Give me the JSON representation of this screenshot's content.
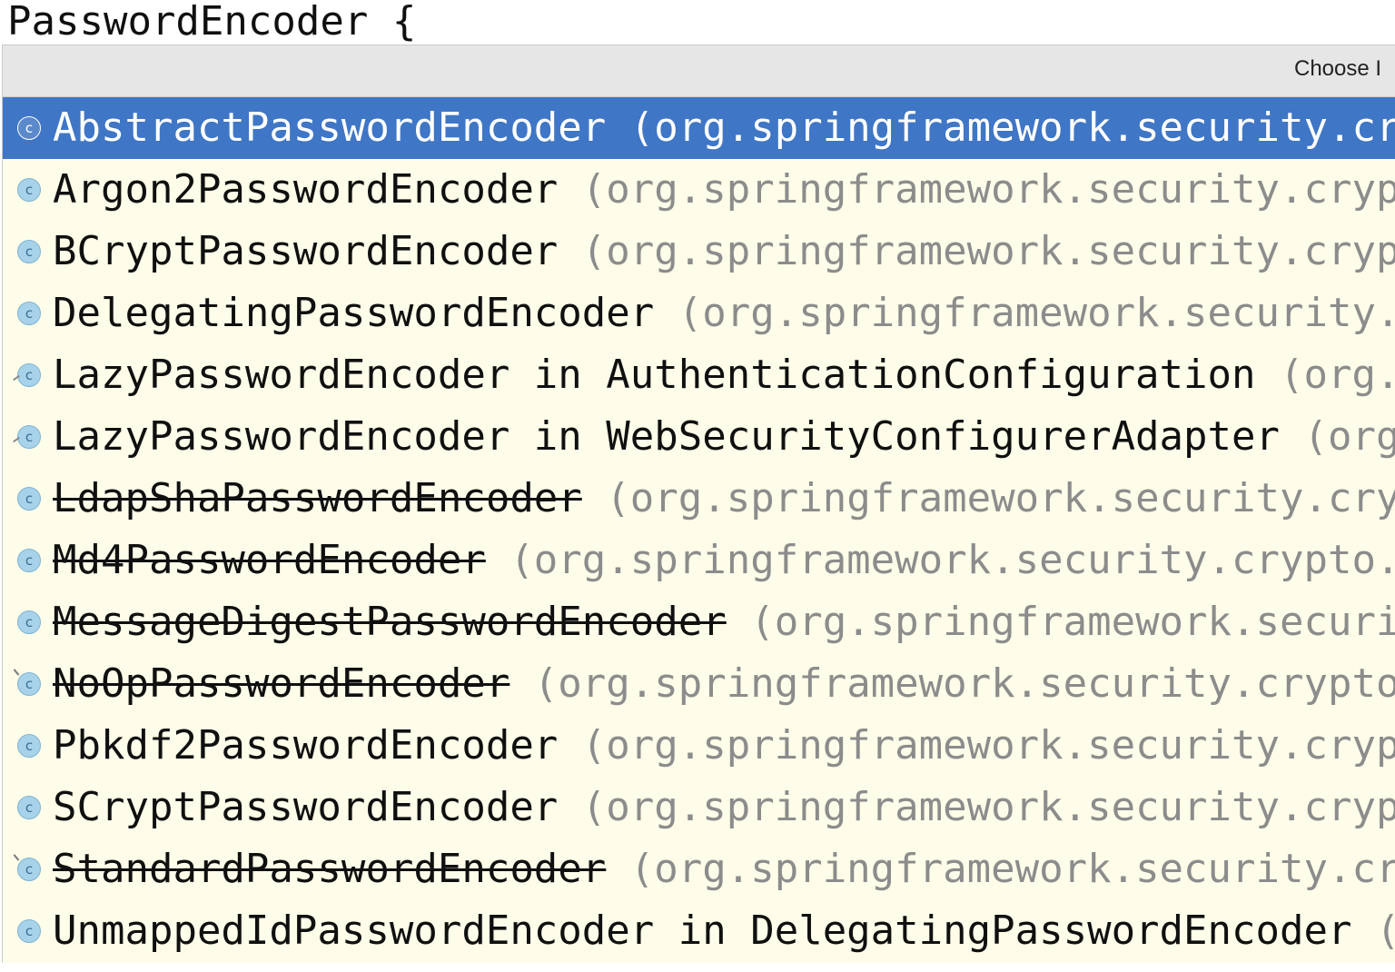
{
  "editor": {
    "code_line": "PasswordEncoder {"
  },
  "popup": {
    "title": "Choose I",
    "items": [
      {
        "name": "AbstractPasswordEncoder",
        "package": " (org.springframework.security.cr",
        "selected": true,
        "deprecated": false,
        "icon": "abstract-class-icon"
      },
      {
        "name": "Argon2PasswordEncoder",
        "package": " (org.springframework.security.crypt",
        "selected": false,
        "deprecated": false,
        "icon": "class-icon"
      },
      {
        "name": "BCryptPasswordEncoder",
        "package": " (org.springframework.security.crypt",
        "selected": false,
        "deprecated": false,
        "icon": "class-icon"
      },
      {
        "name": "DelegatingPasswordEncoder",
        "package": " (org.springframework.security.c",
        "selected": false,
        "deprecated": false,
        "icon": "class-icon"
      },
      {
        "name": "LazyPasswordEncoder in AuthenticationConfiguration",
        "package": " (org.",
        "selected": false,
        "deprecated": false,
        "icon": "inner-class-icon"
      },
      {
        "name": "LazyPasswordEncoder in WebSecurityConfigurerAdapter",
        "package": " (org",
        "selected": false,
        "deprecated": false,
        "icon": "inner-class-icon"
      },
      {
        "name": "LdapShaPasswordEncoder",
        "package": " (org.springframework.security.cry",
        "selected": false,
        "deprecated": true,
        "icon": "class-icon"
      },
      {
        "name": "Md4PasswordEncoder",
        "package": " (org.springframework.security.crypto.",
        "selected": false,
        "deprecated": true,
        "icon": "class-icon"
      },
      {
        "name": "MessageDigestPasswordEncoder",
        "package": " (org.springframework.securi",
        "selected": false,
        "deprecated": true,
        "icon": "class-icon"
      },
      {
        "name": "NoOpPasswordEncoder",
        "package": " (org.springframework.security.crypto",
        "selected": false,
        "deprecated": true,
        "icon": "marked-class-icon"
      },
      {
        "name": "Pbkdf2PasswordEncoder",
        "package": " (org.springframework.security.cryp",
        "selected": false,
        "deprecated": false,
        "icon": "class-icon"
      },
      {
        "name": "SCryptPasswordEncoder",
        "package": " (org.springframework.security.cryp",
        "selected": false,
        "deprecated": false,
        "icon": "class-icon"
      },
      {
        "name": "StandardPasswordEncoder",
        "package": " (org.springframework.security.cr",
        "selected": false,
        "deprecated": true,
        "icon": "marked-class-icon"
      },
      {
        "name": "UnmappedIdPasswordEncoder in DelegatingPasswordEncoder",
        "package": " (",
        "selected": false,
        "deprecated": false,
        "icon": "class-icon"
      }
    ]
  },
  "colors": {
    "selection": "#3f76c6",
    "popup_background": "#fefde9",
    "header_background": "#e6e6e6",
    "package_text": "#8c8c8c",
    "class_icon": "#a7d2ea"
  }
}
